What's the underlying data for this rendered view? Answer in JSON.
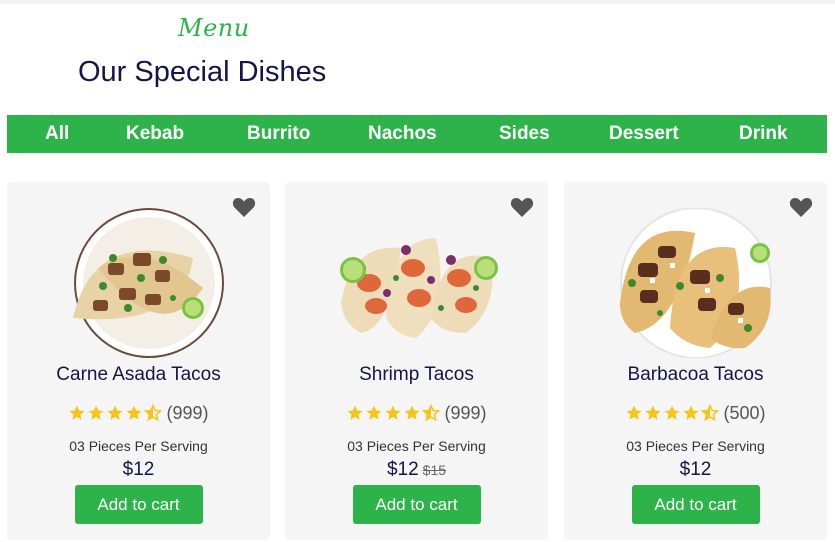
{
  "header": {
    "subtitle": "Menu",
    "title": "Our Special Dishes"
  },
  "categories": [
    "All",
    "Kebab",
    "Burrito",
    "Nachos",
    "Sides",
    "Dessert",
    "Drink"
  ],
  "colors": {
    "accent": "#2db34a",
    "heading": "#14144a",
    "star": "#f5c518",
    "heart": "#555555",
    "card_bg": "#f5f5f5"
  },
  "icons": {
    "favorite": "heart-icon",
    "rating": "star-icon"
  },
  "dishes": [
    {
      "name": "Carne Asada Tacos",
      "rating": 4.5,
      "reviews": "(999)",
      "serving": "03 Pieces Per Serving",
      "price": "$12",
      "old_price": "",
      "button": "Add to cart"
    },
    {
      "name": "Shrimp Tacos",
      "rating": 4.5,
      "reviews": "(999)",
      "serving": "03 Pieces Per Serving",
      "price": "$12",
      "old_price": "$15",
      "button": "Add to cart"
    },
    {
      "name": "Barbacoa Tacos",
      "rating": 4.5,
      "reviews": "(500)",
      "serving": "03 Pieces Per Serving",
      "price": "$12",
      "old_price": "",
      "button": "Add to cart"
    }
  ]
}
